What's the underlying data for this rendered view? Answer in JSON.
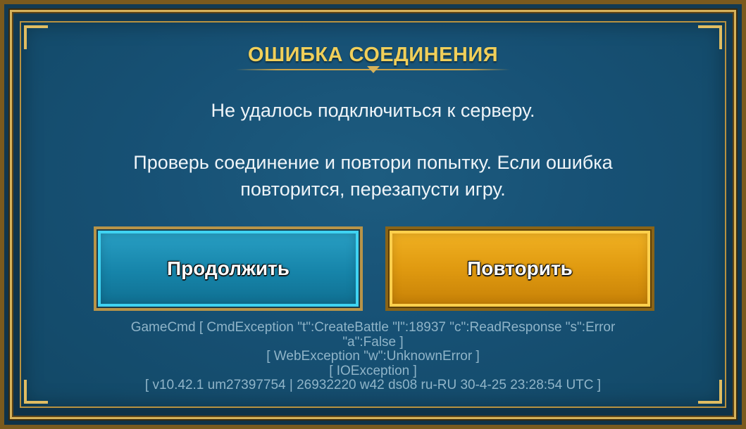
{
  "dialog": {
    "title": "ОШИБКА СОЕДИНЕНИЯ",
    "message_line1": "Не удалось подключиться к серверу.",
    "message_line2": "Проверь соединение и повтори попытку. Если ошибка",
    "message_line3": "повторится, перезапусти игру.",
    "buttons": {
      "continue_label": "Продолжить",
      "retry_label": "Повторить"
    },
    "debug_lines": [
      "GameCmd [ CmdException \"t\":CreateBattle \"l\":18937 \"c\":ReadResponse \"s\":Error",
      "\"a\":False ]",
      "[ WebException \"w\":UnknownError ]",
      "[ IOException ]",
      "[ v10.42.1  um27397754 | 26932220  w42  ds08  ru-RU  30-4-25 23:28:54 UTC ]"
    ]
  },
  "colors": {
    "title": "#f0cf5a",
    "panel": "#175175",
    "frame_gold": "#d6b25a",
    "continue_button": "#1684a9",
    "retry_button": "#e09a10",
    "debug_text": "#8fb4c8"
  }
}
